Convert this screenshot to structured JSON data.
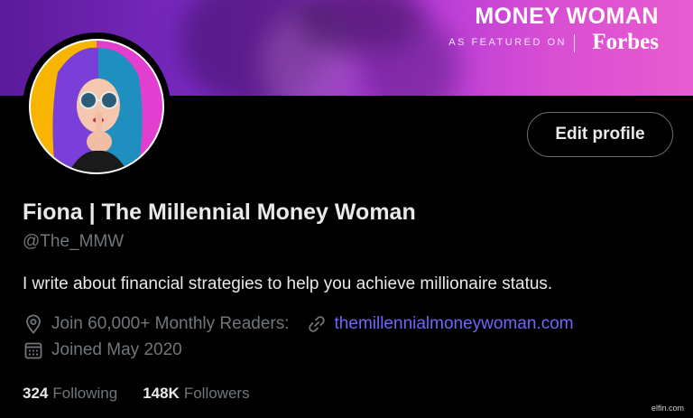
{
  "banner": {
    "title": "MONEY WOMAN",
    "featured_text": "AS FEATURED ON",
    "featured_brand": "Forbes",
    "colors": {
      "start": "#5b1a9a",
      "end": "#e85bd0"
    }
  },
  "avatar": {
    "alt": "avatar"
  },
  "edit_button": {
    "label": "Edit profile"
  },
  "profile": {
    "name": "Fiona | The Millennial Money Woman",
    "handle": "@The_MMW",
    "bio": "I write about financial strategies to help you achieve millionaire status.",
    "location": "Join 60,000+ Monthly Readers:",
    "website": "themillennialmoneywoman.com",
    "joined": "Joined May 2020"
  },
  "stats": {
    "following_count": "324",
    "following_label": "Following",
    "followers_count": "148K",
    "followers_label": "Followers"
  },
  "watermark": "elfin.com",
  "colors": {
    "background": "#000000",
    "text_primary": "#e7e9ea",
    "text_secondary": "#71767b",
    "link": "#6f65ff"
  }
}
